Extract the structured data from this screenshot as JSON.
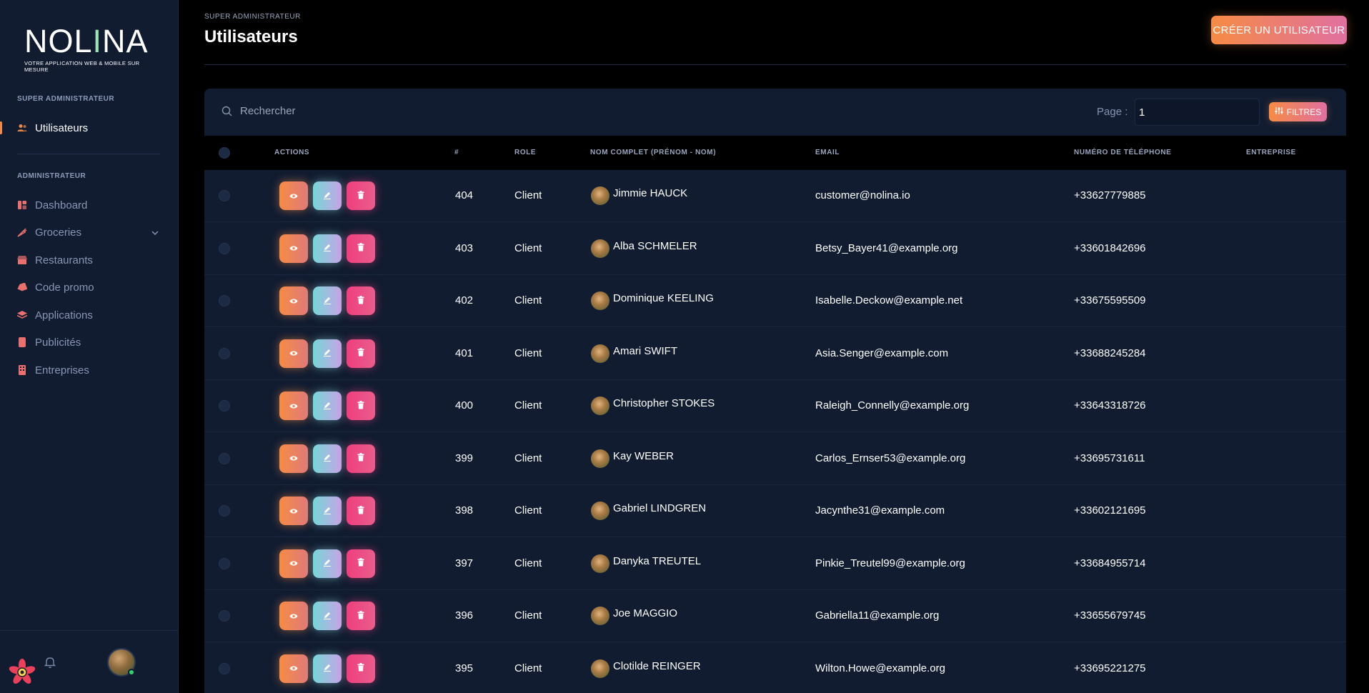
{
  "brand": {
    "name_part1": "NOL",
    "name_part2": "I",
    "name_part3": "NA",
    "tagline": "VOTRE APPLICATION WEB & MOBILE SUR MESURE"
  },
  "sidebar": {
    "section_super": "SUPER ADMINISTRATEUR",
    "section_admin": "ADMINISTRATEUR",
    "items_super": [
      {
        "label": "Utilisateurs",
        "icon": "users-icon",
        "active": true
      }
    ],
    "items_admin": [
      {
        "label": "Dashboard",
        "icon": "dashboard-icon"
      },
      {
        "label": "Groceries",
        "icon": "carrot-icon",
        "has_submenu": true
      },
      {
        "label": "Restaurants",
        "icon": "store-icon"
      },
      {
        "label": "Code promo",
        "icon": "tag-icon"
      },
      {
        "label": "Applications",
        "icon": "layers-icon"
      },
      {
        "label": "Publicités",
        "icon": "ad-icon"
      },
      {
        "label": "Entreprises",
        "icon": "building-icon"
      }
    ]
  },
  "header": {
    "breadcrumb": "SUPER ADMINISTRATEUR",
    "title": "Utilisateurs",
    "create_button": "CRÉER UN UTILISATEUR"
  },
  "toolbar": {
    "search_placeholder": "Rechercher",
    "page_label": "Page :",
    "page_value": "1",
    "filter_button": "FILTRES"
  },
  "table": {
    "headers": {
      "actions": "ACTIONS",
      "id": "#",
      "role": "ROLE",
      "name": "NOM COMPLET (PRÉNOM - NOM)",
      "email": "EMAIL",
      "phone": "NUMÉRO DE TÉLÉPHONE",
      "company": "ENTREPRISE"
    },
    "rows": [
      {
        "id": "404",
        "role": "Client",
        "name": "Jimmie HAUCK",
        "email": "customer@nolina.io",
        "phone": "+33627779885",
        "company": ""
      },
      {
        "id": "403",
        "role": "Client",
        "name": "Alba SCHMELER",
        "email": "Betsy_Bayer41@example.org",
        "phone": "+33601842696",
        "company": ""
      },
      {
        "id": "402",
        "role": "Client",
        "name": "Dominique KEELING",
        "email": "Isabelle.Deckow@example.net",
        "phone": "+33675595509",
        "company": ""
      },
      {
        "id": "401",
        "role": "Client",
        "name": "Amari SWIFT",
        "email": "Asia.Senger@example.com",
        "phone": "+33688245284",
        "company": ""
      },
      {
        "id": "400",
        "role": "Client",
        "name": "Christopher STOKES",
        "email": "Raleigh_Connelly@example.org",
        "phone": "+33643318726",
        "company": ""
      },
      {
        "id": "399",
        "role": "Client",
        "name": "Kay WEBER",
        "email": "Carlos_Ernser53@example.org",
        "phone": "+33695731611",
        "company": ""
      },
      {
        "id": "398",
        "role": "Client",
        "name": "Gabriel LINDGREN",
        "email": "Jacynthe31@example.com",
        "phone": "+33602121695",
        "company": ""
      },
      {
        "id": "397",
        "role": "Client",
        "name": "Danyka TREUTEL",
        "email": "Pinkie_Treutel99@example.org",
        "phone": "+33684955714",
        "company": ""
      },
      {
        "id": "396",
        "role": "Client",
        "name": "Joe MAGGIO",
        "email": "Gabriella11@example.org",
        "phone": "+33655679745",
        "company": ""
      },
      {
        "id": "395",
        "role": "Client",
        "name": "Clotilde REINGER",
        "email": "Wilton.Howe@example.org",
        "phone": "+33695221275",
        "company": ""
      }
    ]
  },
  "colors": {
    "accent_orange": "#f68b45",
    "accent_pink": "#e0709f",
    "sidebar_bg": "#111c31",
    "danger": "#ef3f7e"
  }
}
